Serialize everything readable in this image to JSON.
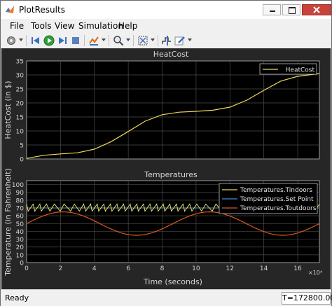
{
  "window": {
    "title": "PlotResults"
  },
  "menu": [
    "File",
    "Tools",
    "View",
    "Simulation",
    "Help"
  ],
  "status": {
    "text": "Ready",
    "time": "T=172800.000"
  },
  "colors": {
    "yellow": "#f0d858",
    "blue": "#3e8fd8",
    "orange": "#d95a1c",
    "plot_bg": "#000000",
    "figure_bg": "#262626"
  },
  "chart_data": [
    {
      "type": "line",
      "title": "HeatCost",
      "xlabel": "",
      "ylabel": "HeatCost (in $)",
      "xlim": [
        0,
        172800
      ],
      "ylim": [
        0,
        35
      ],
      "yticks": [
        "0",
        "5",
        "10",
        "15",
        "20",
        "25",
        "30",
        "35"
      ],
      "grid": true,
      "legend_placement": "top-right",
      "series": [
        {
          "name": "HeatCost",
          "color": "#f0d858",
          "x": [
            0,
            10000,
            20000,
            30000,
            40000,
            50000,
            60000,
            70000,
            80000,
            90000,
            100000,
            110000,
            120000,
            130000,
            140000,
            150000,
            160000,
            172800
          ],
          "y": [
            0.2,
            1.3,
            1.8,
            2.2,
            3.5,
            6.2,
            9.8,
            13.5,
            15.8,
            16.7,
            17.0,
            17.4,
            18.5,
            21.0,
            24.5,
            27.8,
            29.5,
            30.5
          ]
        }
      ]
    },
    {
      "type": "line",
      "title": "Temperatures",
      "xlabel": "Time (seconds)",
      "ylabel": "Temperature (in Fahrenheit)",
      "x_exponent": "×10⁴",
      "xlim": [
        0,
        172800
      ],
      "ylim": [
        0,
        105
      ],
      "yticks": [
        "0",
        "10",
        "20",
        "30",
        "40",
        "50",
        "60",
        "70",
        "80",
        "90",
        "100"
      ],
      "xticks": [
        "0",
        "2",
        "4",
        "6",
        "8",
        "10",
        "12",
        "14",
        "16"
      ],
      "grid": true,
      "legend_placement": "top-right",
      "series": [
        {
          "name": "Temperatures.Tindoors",
          "color": "#f0d858",
          "style": "sawtooth",
          "low": 66,
          "high": 75
        },
        {
          "name": "Temperatures.Set Point",
          "color": "#3e8fd8",
          "value": 70
        },
        {
          "name": "Temperatures.Toutdoors",
          "color": "#d95a1c",
          "mean": 50,
          "amplitude": 15,
          "period": 86400,
          "min_at": 64800
        }
      ]
    }
  ]
}
